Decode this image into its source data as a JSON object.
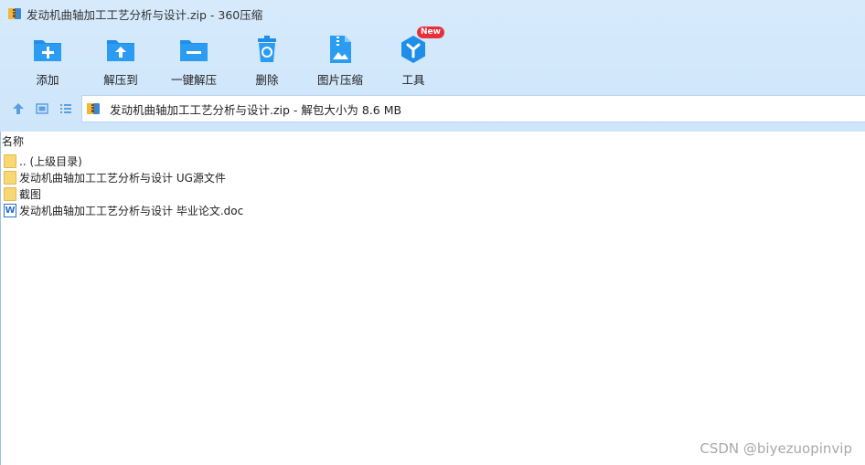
{
  "window": {
    "title": "发动机曲轴加工工艺分析与设计.zip - 360压缩"
  },
  "toolbar": {
    "items": [
      {
        "label": "添加",
        "icon": "add-folder-icon"
      },
      {
        "label": "解压到",
        "icon": "extract-to-icon"
      },
      {
        "label": "一键解压",
        "icon": "one-click-extract-icon"
      },
      {
        "label": "删除",
        "icon": "delete-icon"
      },
      {
        "label": "图片压缩",
        "icon": "image-compress-icon"
      },
      {
        "label": "工具",
        "icon": "tools-icon",
        "badge": "New"
      }
    ]
  },
  "address": {
    "text": "发动机曲轴加工工艺分析与设计.zip - 解包大小为 8.6 MB"
  },
  "list": {
    "header": "名称",
    "items": [
      {
        "name": ".. (上级目录)",
        "type": "folder"
      },
      {
        "name": "发动机曲轴加工工艺分析与设计 UG源文件",
        "type": "folder"
      },
      {
        "name": "截图",
        "type": "folder"
      },
      {
        "name": "发动机曲轴加工工艺分析与设计 毕业论文.doc",
        "type": "doc"
      }
    ]
  },
  "doc_icon_letter": "W",
  "watermark": "CSDN @biyezuopinvip",
  "colors": {
    "accent": "#1e8ee8",
    "top_bg": "#d3e8fb",
    "badge": "#e8303a"
  }
}
